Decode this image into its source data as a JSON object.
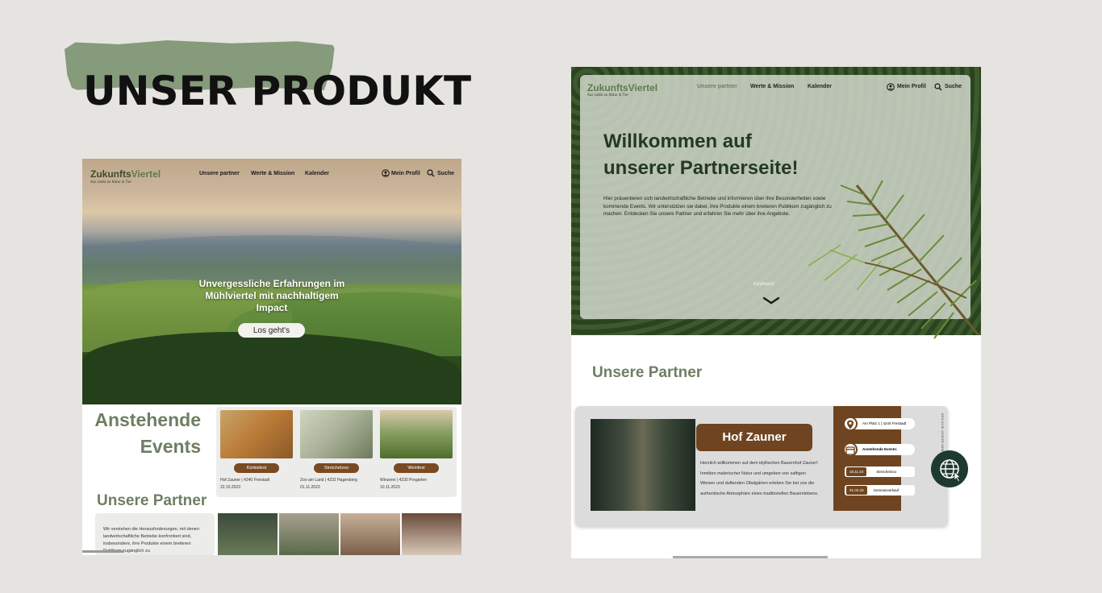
{
  "headline": "UNSER PRODUKT",
  "left": {
    "logo": "ZukunftsViertel",
    "logo_part1": "Zukunfts",
    "logo_part2": "Viertel",
    "tagline": "Aus Liebe zu Natur & Tier",
    "nav": [
      "Unsere partner",
      "Werte & Mission",
      "Kalender"
    ],
    "profile": "Mein Profil",
    "search": "Suche",
    "hero_text": "Unvergessliche Erfahrungen im Mühlviertel mit nachhaltigem Impact",
    "hero_button": "Los geht's",
    "events_heading_line1": "Anstehende",
    "events_heading_line2": "Events",
    "events": [
      {
        "name": "Kürbisfest",
        "place": "Hof Zauner | 4240 Freistadt",
        "date": "22.10.2023",
        "color": "#b97a35"
      },
      {
        "name": "Streichelzoo",
        "place": "Zoo am Land | 4232 Hagenberg",
        "date": "01.11.2023",
        "color": "#8a9a78"
      },
      {
        "name": "Weinfest",
        "place": "Winzerei | 4230 Pregarten",
        "date": "10.11.2023",
        "color": "#6f8a4e"
      }
    ],
    "partner_heading": "Unsere Partner",
    "partner_text": "Wir verstehen die Herausforderungen, mit denen landwirtschaftliche Betriebe konfrontiert sind, insbesondere, ihre Produkte einem breiteren Publikum zugänglich zu"
  },
  "right": {
    "logo": "ZukunftsViertel",
    "logo_part1": "Zukunfts",
    "logo_part2": "Viertel",
    "tagline": "Aus Liebe zu Natur & Tier",
    "nav": [
      "Unsere partner",
      "Werte & Mission",
      "Kalender"
    ],
    "profile": "Mein Profil",
    "search": "Suche",
    "welcome_line1": "Willkommen auf",
    "welcome_line2": "unserer Partnerseite!",
    "intro": "Hier präsentieren sich landwirtschaftliche Betriebe und informieren über ihre Besonderheiten sowie kommende Events. Wir unterstützen sie dabei, ihre Produkte einem breiteren Publikum zugänglich zu machen. Entdecken Sie unsere Partner und erfahren Sie mehr über ihre Angebote.",
    "keyboard": "Keyboard",
    "section_heading": "Unsere Partner",
    "partner_name": "Hof Zauner",
    "partner_text": "Herzlich willkommen auf dem idyllischen Bauernhof Zauner! Inmitten malerischer Natur und umgeben von saftigen Wiesen und duftenden Obstgärten erleben Sie bei uns die authentische Atmosphäre eines traditionellen Bauernlebens.",
    "address": "Am Platz 1 | 4240 Freistadt",
    "events_label": "Anstehende Events:",
    "events": [
      {
        "date": "18.11.23",
        "name": "Streichelzoo"
      },
      {
        "date": "01.02.23",
        "name": "Gemüseverkauf"
      }
    ],
    "vertical_text": "BESUCHE UNSERE WEBSITE"
  },
  "colors": {
    "accent_green": "#6f7e62",
    "brown": "#6e4520",
    "dark": "#1e3a2e"
  }
}
